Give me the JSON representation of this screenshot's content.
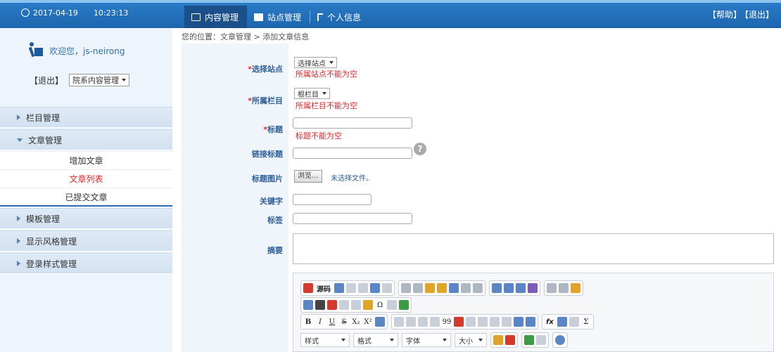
{
  "topbar": {
    "date": "2017-04-19",
    "time": "10:23:13",
    "tabs": [
      {
        "label": "内容管理",
        "icon": "document-icon"
      },
      {
        "label": "站点管理",
        "icon": "id-card-icon"
      },
      {
        "label": "个人信息",
        "icon": "person-icon"
      }
    ],
    "help": "【帮助】",
    "logout": "【退出】",
    "color": "#1d66ae"
  },
  "sidebar": {
    "welcome": "欢迎您，js-neirong",
    "logout": "【退出】",
    "dept_select": "院系内容管理",
    "menu": [
      {
        "label": "栏目管理"
      },
      {
        "label": "文章管理"
      },
      {
        "label": "模板管理"
      },
      {
        "label": "显示风格管理"
      },
      {
        "label": "登录样式管理"
      }
    ],
    "submenu": [
      {
        "label": "增加文章"
      },
      {
        "label": "文章列表"
      },
      {
        "label": "已提交文章"
      }
    ]
  },
  "breadcrumb": "您的位置：文章管理 > 添加文章信息",
  "form": {
    "site_label": "选择站点",
    "site_select": "选择站点",
    "site_error": "所属站点不能为空",
    "column_label": "所属栏目",
    "column_select": "根栏目",
    "column_error": "所属栏目不能为空",
    "title_label": "标题",
    "title_error": "标题不能为空",
    "link_title_label": "链接标题",
    "image_label": "标题图片",
    "browse": "浏览...",
    "no_file": "未选择文件。",
    "keywords_label": "关键字",
    "tag_label": "标签",
    "summary_label": "摘要",
    "required_mark": "*"
  },
  "editor": {
    "source": "源码",
    "bold": "B",
    "italic": "I",
    "underline": "U",
    "strike": "S",
    "sub": "X₂",
    "sup": "X²",
    "quote": "99",
    "formula": "fx",
    "sigma": "Σ",
    "omega": "Ω",
    "combos": [
      "样式",
      "格式",
      "字体",
      "大小"
    ]
  }
}
